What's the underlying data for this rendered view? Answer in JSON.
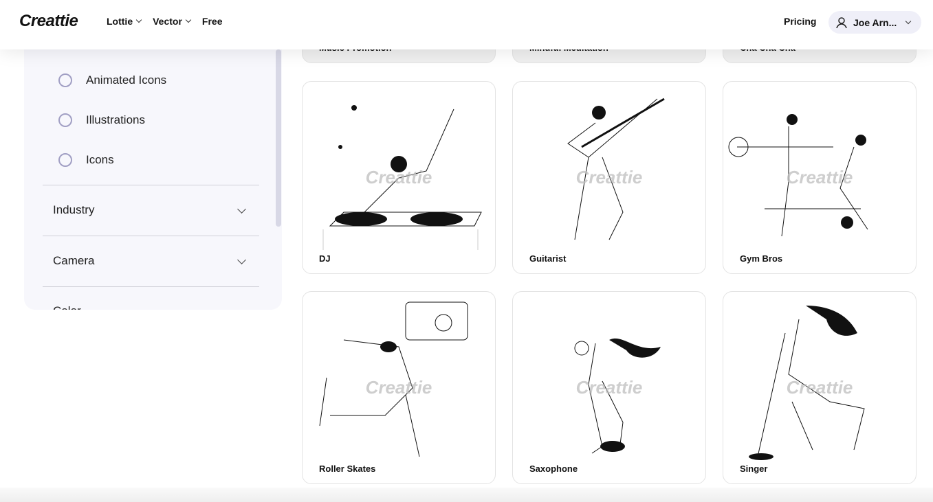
{
  "header": {
    "logo": "Creattie",
    "nav": [
      {
        "label": "Lottie",
        "has_dropdown": true
      },
      {
        "label": "Vector",
        "has_dropdown": true
      },
      {
        "label": "Free",
        "has_dropdown": false
      }
    ],
    "pricing": "Pricing",
    "user": {
      "name": "Joe Arn...",
      "icon": "user-icon"
    }
  },
  "sidebar": {
    "radios": [
      {
        "label": "Animated Icons",
        "checked": false
      },
      {
        "label": "Illustrations",
        "checked": false
      },
      {
        "label": "Icons",
        "checked": false
      }
    ],
    "accordions": [
      {
        "label": "Industry"
      },
      {
        "label": "Camera"
      },
      {
        "label": "Color"
      }
    ]
  },
  "cards": [
    {
      "title": "Music Promotion"
    },
    {
      "title": "Mindful Meditation"
    },
    {
      "title": "Cha Cha Cha"
    },
    {
      "title": "DJ"
    },
    {
      "title": "Guitarist"
    },
    {
      "title": "Gym Bros"
    },
    {
      "title": "Roller Skates"
    },
    {
      "title": "Saxophone"
    },
    {
      "title": "Singer"
    }
  ],
  "watermark": "Creattie"
}
